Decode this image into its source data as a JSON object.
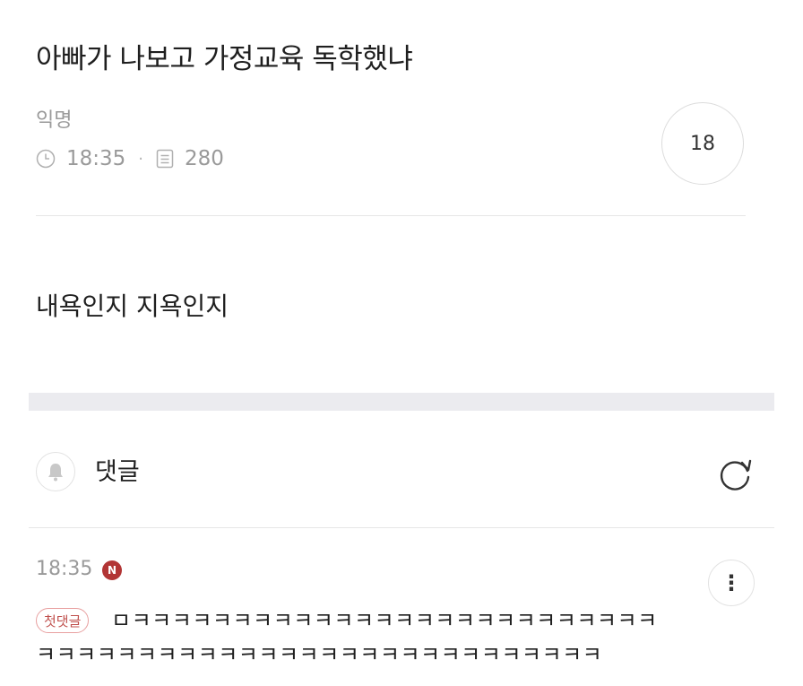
{
  "post": {
    "title": "아빠가 나보고 가정교육 독학했냐",
    "author": "익명",
    "time": "18:35",
    "views": "280",
    "likes": "18",
    "body": "내욕인지 지욕인지"
  },
  "comments": {
    "label": "댓글",
    "items": [
      {
        "time": "18:35",
        "new_badge": "N",
        "first_badge": "첫댓글",
        "text_line1": "ㅁㅋㅋㅋㅋㅋㅋㅋㅋㅋㅋㅋㅋㅋㅋㅋㅋㅋㅋㅋㅋㅋㅋㅋㅋㅋㅋ",
        "text_line2": "ㅋㅋㅋㅋㅋㅋㅋㅋㅋㅋㅋㅋㅋㅋㅋㅋㅋㅋㅋㅋㅋㅋㅋㅋㅋㅋㅋㅋ"
      }
    ]
  },
  "icons": {
    "clock": "clock-icon",
    "views": "document-icon",
    "bell": "bell-icon",
    "refresh": "refresh-icon",
    "more": "more-vertical-icon"
  },
  "colors": {
    "badge_new": "#b23535",
    "badge_first": "#c0504d",
    "muted_text": "#9a9a9a"
  }
}
